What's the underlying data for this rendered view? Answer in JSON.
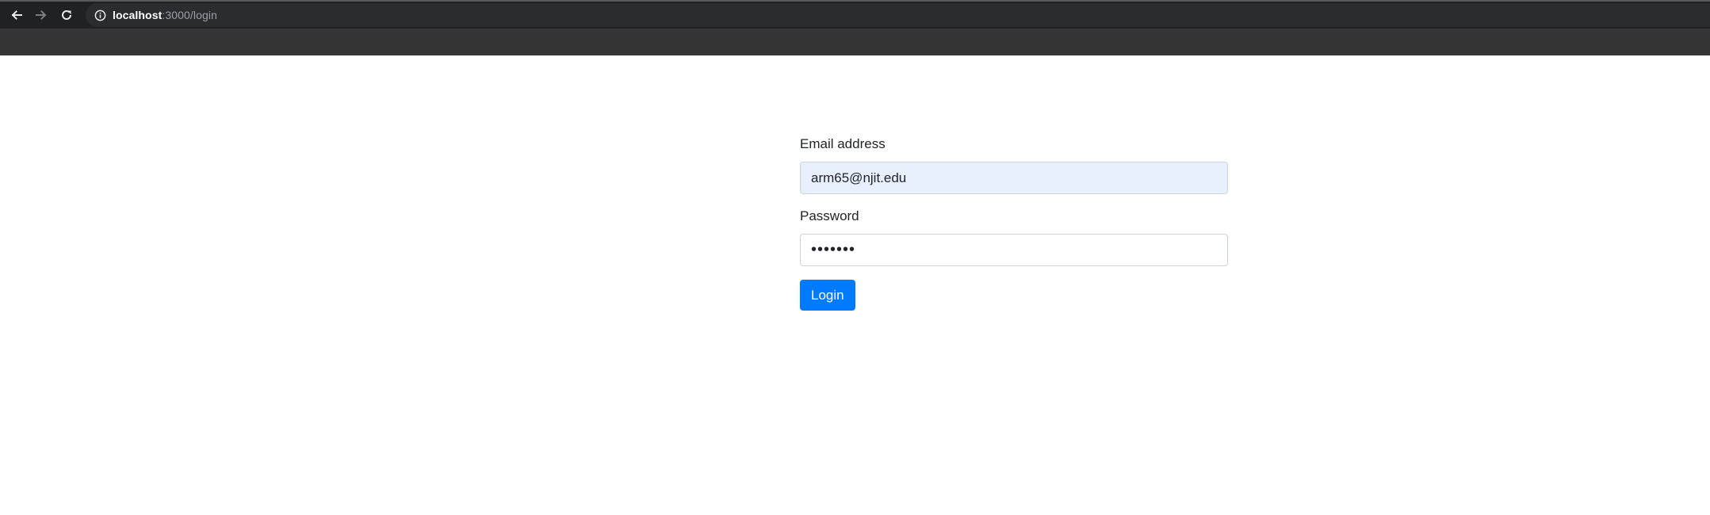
{
  "browser": {
    "url_host": "localhost",
    "url_path": ":3000/login",
    "icons": {
      "back": "back-arrow-icon",
      "forward": "forward-arrow-icon",
      "reload": "reload-icon",
      "site_info": "info-icon"
    }
  },
  "login_form": {
    "email_label": "Email address",
    "email_value": "arm65@njit.edu",
    "password_label": "Password",
    "password_value": "•••••••",
    "login_button": "Login"
  },
  "colors": {
    "primary": "#007bff",
    "autofill_bg": "#e8f0fe",
    "chrome_bg": "#353535",
    "toolbar_bg": "#202124"
  }
}
